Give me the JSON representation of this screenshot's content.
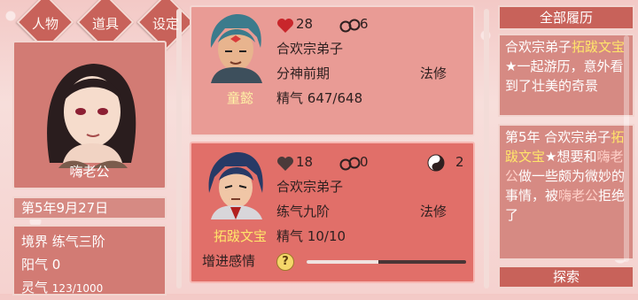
{
  "tabs": [
    {
      "label": "人物"
    },
    {
      "label": "道具"
    },
    {
      "label": "设定"
    }
  ],
  "player": {
    "name": "嗨老公",
    "date": "第5年9月27日",
    "realm_label": "境界",
    "realm_value": "练气三阶",
    "yang_label": "阳气",
    "yang_value": "0",
    "spirit_label": "灵气",
    "spirit_value": "123/1000"
  },
  "characters": [
    {
      "name": "童懿",
      "affection": "28",
      "ring_count": "6",
      "sect": "合欢宗弟子",
      "realm": "分神前期",
      "cultivation": "法修",
      "essence_label": "精气",
      "essence_value": "647/648",
      "heart_color": "#c8262b"
    },
    {
      "name": "拓跋文宝",
      "affection": "18",
      "ring_count": "0",
      "yinyang_count": "2",
      "sect": "合欢宗弟子",
      "realm": "练气九阶",
      "cultivation": "法修",
      "essence_label": "精气",
      "essence_value": "10/10",
      "heart_color": "#4a3a3a",
      "affection_button": "增进感情",
      "affection_progress": 0.45
    }
  ],
  "history": {
    "header": "全部履历",
    "entry1": {
      "p1": "合欢宗弟子",
      "name": "拓跋文宝",
      "p2": "★一起游历，意外看到了壮美的奇景"
    },
    "entry2": {
      "p1": "第5年 合欢宗弟子",
      "name1": "拓跋文宝",
      "p2": "★想要和",
      "name2": "嗨老公",
      "p3": "做一些颇为微妙的事情，被",
      "name3": "嗨老公",
      "p4": "拒绝了"
    },
    "search_label": "探索"
  },
  "icons": {
    "heart": "heart-icon",
    "ring": "ring-icon",
    "yinyang": "yinyang-icon",
    "question": "question-icon"
  }
}
